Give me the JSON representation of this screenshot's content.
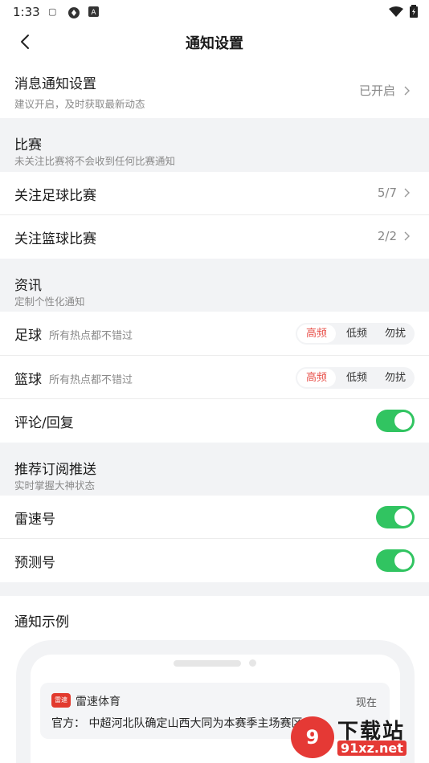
{
  "status_bar": {
    "time": "1:33",
    "icons": [
      "cn-icon",
      "nfc-icon",
      "a-icon"
    ],
    "right_icons": [
      "wifi-icon",
      "battery-icon"
    ]
  },
  "nav": {
    "title": "通知设置",
    "back_icon": "chevron-left-icon"
  },
  "message_notification": {
    "label": "消息通知设置",
    "sub": "建议开启，及时获取最新动态",
    "value": "已开启"
  },
  "match": {
    "title": "比赛",
    "sub": "未关注比赛将不会收到任何比赛通知",
    "rows": [
      {
        "label": "关注足球比赛",
        "value": "5/7"
      },
      {
        "label": "关注篮球比赛",
        "value": "2/2"
      }
    ]
  },
  "news": {
    "title": "资讯",
    "sub": "定制个性化通知",
    "rows": [
      {
        "label": "足球",
        "sub": "所有热点都不错过",
        "options": [
          "高频",
          "低频",
          "勿扰"
        ],
        "selected": "高频"
      },
      {
        "label": "篮球",
        "sub": "所有热点都不错过",
        "options": [
          "高频",
          "低频",
          "勿扰"
        ],
        "selected": "高频"
      }
    ],
    "comment": {
      "label": "评论/回复",
      "enabled": true
    }
  },
  "subscribe": {
    "title": "推荐订阅推送",
    "sub": "实时掌握大神状态",
    "rows": [
      {
        "label": "雷速号",
        "enabled": true
      },
      {
        "label": "预测号",
        "enabled": true
      }
    ]
  },
  "example": {
    "title": "通知示例",
    "app_name": "雷速体育",
    "time": "现在",
    "message": "官方：  中超河北队确定山西大同为本赛季主场赛区"
  },
  "watermark": {
    "top": "下载站",
    "bottom": "91xz.net"
  },
  "colors": {
    "accent": "#e8504a",
    "toggle_on": "#31c461",
    "background": "#f2f3f5"
  }
}
